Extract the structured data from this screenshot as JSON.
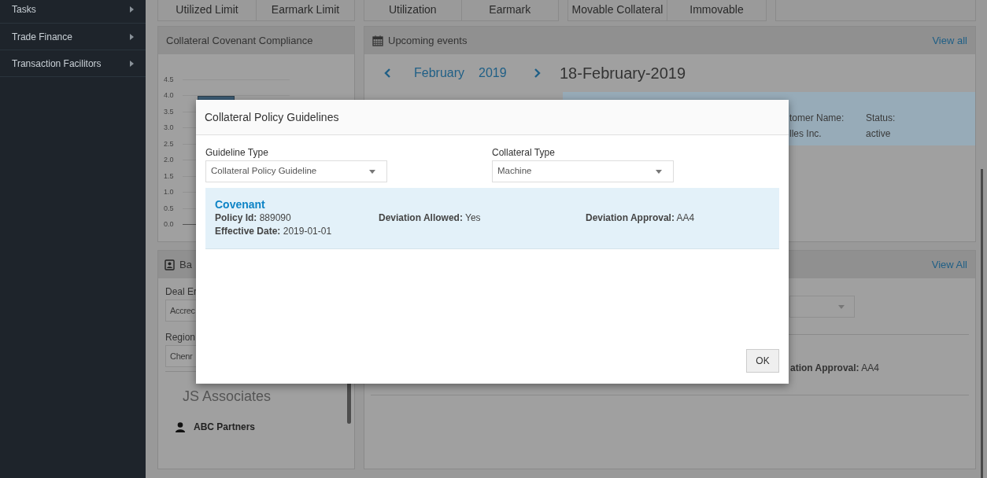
{
  "sidebar": {
    "items": [
      {
        "label": "Tasks"
      },
      {
        "label": "Trade Finance"
      },
      {
        "label": "Transaction Facilitors"
      }
    ]
  },
  "summary_tabs": [
    [
      "Utilized Limit",
      "Earmark Limit"
    ],
    [
      "Utilization",
      "Earmark"
    ],
    [
      "Movable Collateral",
      "Immovable"
    ]
  ],
  "compliance_card": {
    "title": "Collateral Covenant Compliance",
    "y_ticks": [
      "4.5",
      "4.0",
      "3.5",
      "3.0",
      "2.5",
      "2.0",
      "1.5",
      "1.0",
      "0.5",
      "0.0"
    ]
  },
  "events_card": {
    "title": "Upcoming events",
    "view_all": "View all",
    "month": "February",
    "year": "2019",
    "selected_date": "18-February-2019",
    "event": {
      "customer_label": "tomer Name:",
      "customer_value": "lles Inc.",
      "status_label": "Status:",
      "status_value": "active"
    }
  },
  "parties_card": {
    "title": "Ba",
    "fields": [
      {
        "label": "Deal Er",
        "value": "Accrec"
      },
      {
        "label": "Region",
        "value": "Chenr"
      }
    ],
    "group_title": "JS Associates",
    "items": [
      {
        "name": "ABC Partners"
      }
    ]
  },
  "guidelines_card": {
    "view_all": "View All",
    "detail": "**ation Approval:** AA4"
  },
  "dialog": {
    "title": "Collateral Policy Guidelines",
    "fields": [
      {
        "label": "Guideline Type",
        "value": "Collateral Policy Guideline"
      },
      {
        "label": "Collateral Type",
        "value": "Machine"
      }
    ],
    "results": [
      {
        "title": "Covenant",
        "details": [
          "**Policy Id:** 889090",
          "**Deviation Allowed:** Yes",
          "**Deviation Approval:** AA4",
          "**Effective Date:** 2019-01-01"
        ]
      }
    ],
    "ok": "OK"
  }
}
